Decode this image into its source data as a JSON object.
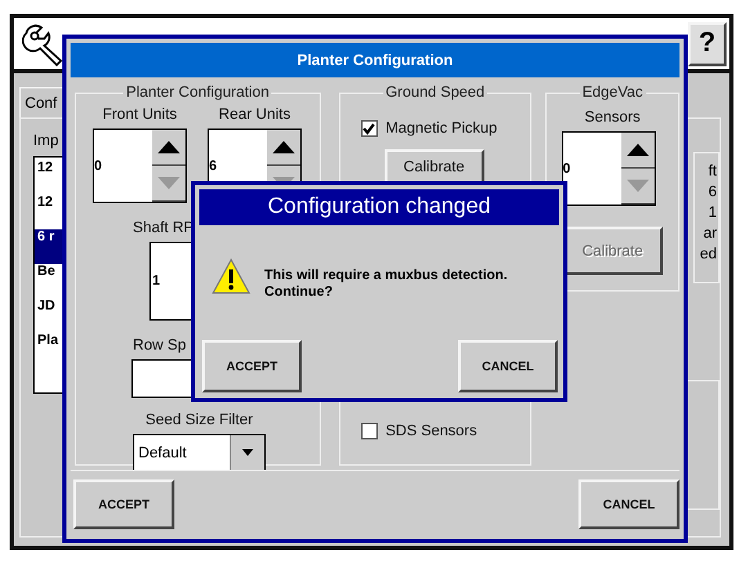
{
  "background": {
    "help_button": "?",
    "tab": {
      "label": "Conf",
      "selected": true
    },
    "list_label": "Imp",
    "list_items": [
      {
        "text": "12",
        "selected": false
      },
      {
        "text": "12",
        "selected": false
      },
      {
        "text": "6 r",
        "selected": true
      },
      {
        "text": "Be",
        "selected": false
      },
      {
        "text": "JD",
        "selected": false
      },
      {
        "text": "Pla",
        "selected": false
      }
    ],
    "right_texts": [
      "ft",
      "6",
      "1",
      "ar",
      "ed"
    ]
  },
  "dialog": {
    "title": "Planter Configuration",
    "planter": {
      "title": "Planter Configuration",
      "spinners": [
        {
          "label": "Front Units",
          "value": "0",
          "up_disabled": false,
          "down_disabled": true
        },
        {
          "label": "Rear Units",
          "value": "6",
          "up_disabled": false,
          "down_disabled": true
        }
      ],
      "shaft": {
        "label": "Shaft RP",
        "value": "1"
      },
      "row": {
        "label": "Row Sp"
      },
      "seed": {
        "label": "Seed Size Filter",
        "value": "Default"
      }
    },
    "ground_speed": {
      "title": "Ground Speed",
      "magnetic_pickup": {
        "label": "Magnetic Pickup",
        "checked": true
      },
      "calibrate": {
        "label": "Calibrate",
        "disabled": false
      },
      "sds_sensors": {
        "label": "SDS Sensors",
        "checked": false
      }
    },
    "edgevac": {
      "title": "EdgeVac",
      "sensors": {
        "label": "Sensors",
        "value": "0",
        "up_disabled": false,
        "down_disabled": true
      },
      "calibrate": {
        "label": "Calibrate",
        "disabled": true
      }
    },
    "buttons": [
      "ACCEPT",
      "CANCEL"
    ]
  },
  "confirm": {
    "title": "Configuration changed",
    "message": "This will require a muxbus detection.",
    "message_2": "Continue?",
    "buttons": [
      "ACCEPT",
      "CANCEL"
    ]
  }
}
